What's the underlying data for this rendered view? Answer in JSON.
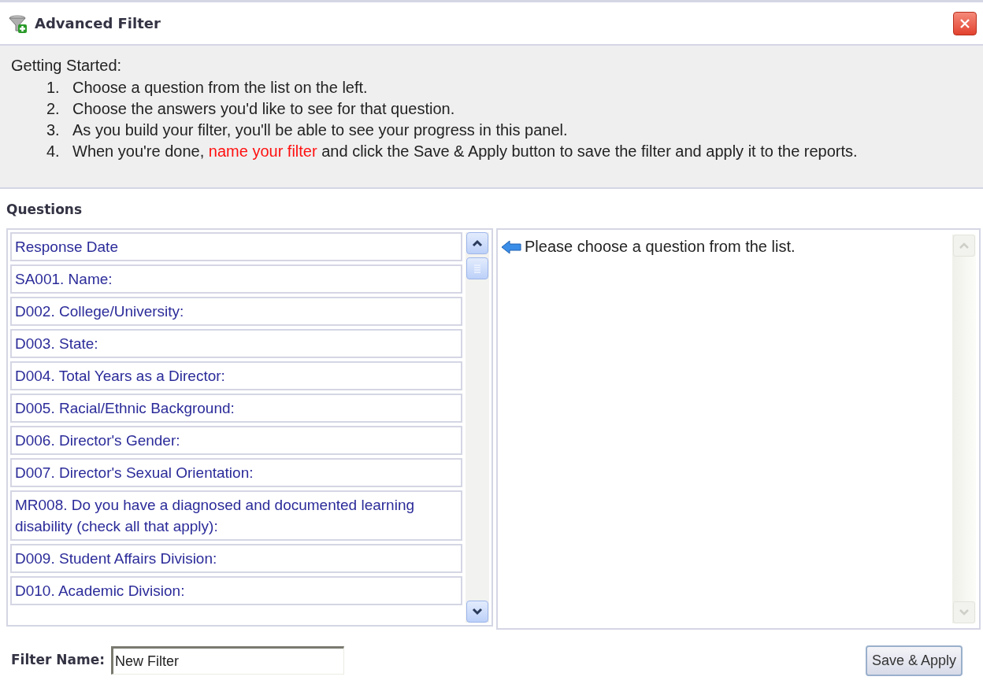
{
  "window": {
    "title": "Advanced Filter"
  },
  "getting_started": {
    "heading": "Getting Started:",
    "steps": [
      {
        "number": "1.",
        "parts": [
          {
            "kind": "plain",
            "text": "Choose a question from the list on the left."
          }
        ]
      },
      {
        "number": "2.",
        "parts": [
          {
            "kind": "plain",
            "text": "Choose the answers you'd like to see for that question."
          }
        ]
      },
      {
        "number": "3.",
        "parts": [
          {
            "kind": "plain",
            "text": "As you build your filter, you'll be able to see your progress in this panel."
          }
        ]
      },
      {
        "number": "4.",
        "parts": [
          {
            "kind": "plain",
            "text": "When you're done, "
          },
          {
            "kind": "link",
            "text": "name your filter"
          },
          {
            "kind": "plain",
            "text": " and click the Save & Apply button to save the filter and apply it to the reports."
          }
        ]
      }
    ]
  },
  "questions": {
    "heading": "Questions",
    "items": [
      {
        "label": "Response Date"
      },
      {
        "label": "SA001. Name:"
      },
      {
        "label": "D002. College/University:"
      },
      {
        "label": "D003. State:"
      },
      {
        "label": "D004. Total Years as a Director:"
      },
      {
        "label": "D005. Racial/Ethnic Background:"
      },
      {
        "label": "D006. Director's Gender:"
      },
      {
        "label": "D007. Director's Sexual Orientation:"
      },
      {
        "label": "MR008. Do you have a diagnosed and documented learning disability (check all that apply):"
      },
      {
        "label": "D009. Student Affairs Division:"
      },
      {
        "label": "D010. Academic Division:"
      }
    ]
  },
  "answers_panel": {
    "message": "Please choose a question from the list."
  },
  "filter_name": {
    "label": "Filter Name:",
    "value": "New Filter"
  },
  "buttons": [
    {
      "label": "Save & Apply"
    }
  ]
}
